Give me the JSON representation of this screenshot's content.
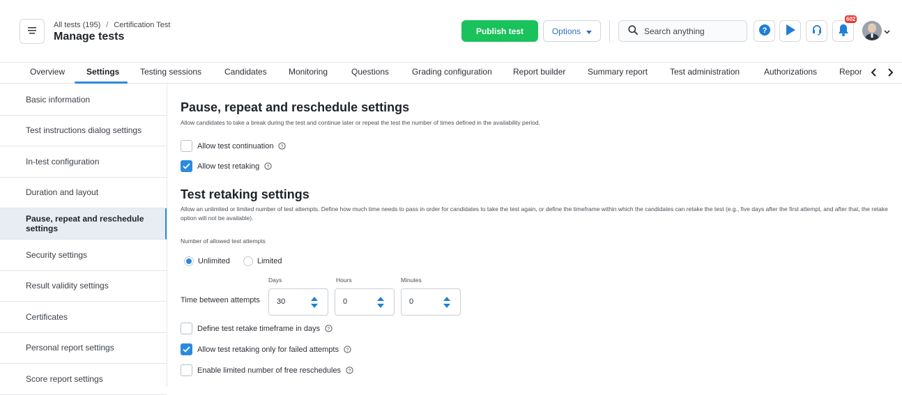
{
  "header": {
    "breadcrumb": [
      "All tests (195)",
      "Certification Test"
    ],
    "breadcrumb_separator": "/",
    "title": "Manage tests",
    "publish_label": "Publish test",
    "options_label": "Options",
    "search_placeholder": "Search anything",
    "notification_count": "602",
    "icons": [
      "menu-icon",
      "help-icon",
      "play-icon",
      "headset-icon",
      "bell-icon",
      "avatar",
      "chevron-down-icon"
    ]
  },
  "tabs": [
    "Overview",
    "Settings",
    "Testing sessions",
    "Candidates",
    "Monitoring",
    "Questions",
    "Grading configuration",
    "Report builder",
    "Summary report",
    "Test administration",
    "Authorizations",
    "Reports"
  ],
  "active_tab": "Settings",
  "sidebar": {
    "items": [
      "Basic information",
      "Test instructions dialog settings",
      "In-test configuration",
      "Duration and layout",
      "Pause, repeat and reschedule settings",
      "Security settings",
      "Result validity settings",
      "Certificates",
      "Personal report settings",
      "Score report settings"
    ],
    "active": "Pause, repeat and reschedule settings"
  },
  "main": {
    "pause_section": {
      "title": "Pause, repeat and reschedule settings",
      "description": "Allow candidates to take a break during the test and continue later or repeat the test the number of times defined in the availability period.",
      "allow_continuation": {
        "label": "Allow test continuation",
        "checked": false
      },
      "allow_retaking": {
        "label": "Allow test retaking",
        "checked": true
      }
    },
    "retake_section": {
      "title": "Test retaking settings",
      "description": "Allow an unlimited or limited number of test attempts. Define how much time needs to pass in order for candidates to take the test again, or define the timeframe within which the candidates can retake the test (e.g., five days after the first attempt, and after that, the retake option will not be available).",
      "attempts_label": "Number of allowed test attempts",
      "radio_unlimited": "Unlimited",
      "radio_limited": "Limited",
      "selected_attempts": "Unlimited",
      "time_between_label": "Time between attempts",
      "days_label": "Days",
      "hours_label": "Hours",
      "minutes_label": "Minutes",
      "days_value": "30",
      "hours_value": "0",
      "minutes_value": "0",
      "define_timeframe": {
        "label": "Define test retake timeframe in days",
        "checked": false
      },
      "only_failed": {
        "label": "Allow test retaking only for failed attempts",
        "checked": true
      },
      "free_reschedules": {
        "label": "Enable limited number of free reschedules",
        "checked": false
      }
    }
  },
  "colors": {
    "primary": "#2a8ae0",
    "publish": "#19c25b",
    "badge": "#e53935"
  }
}
